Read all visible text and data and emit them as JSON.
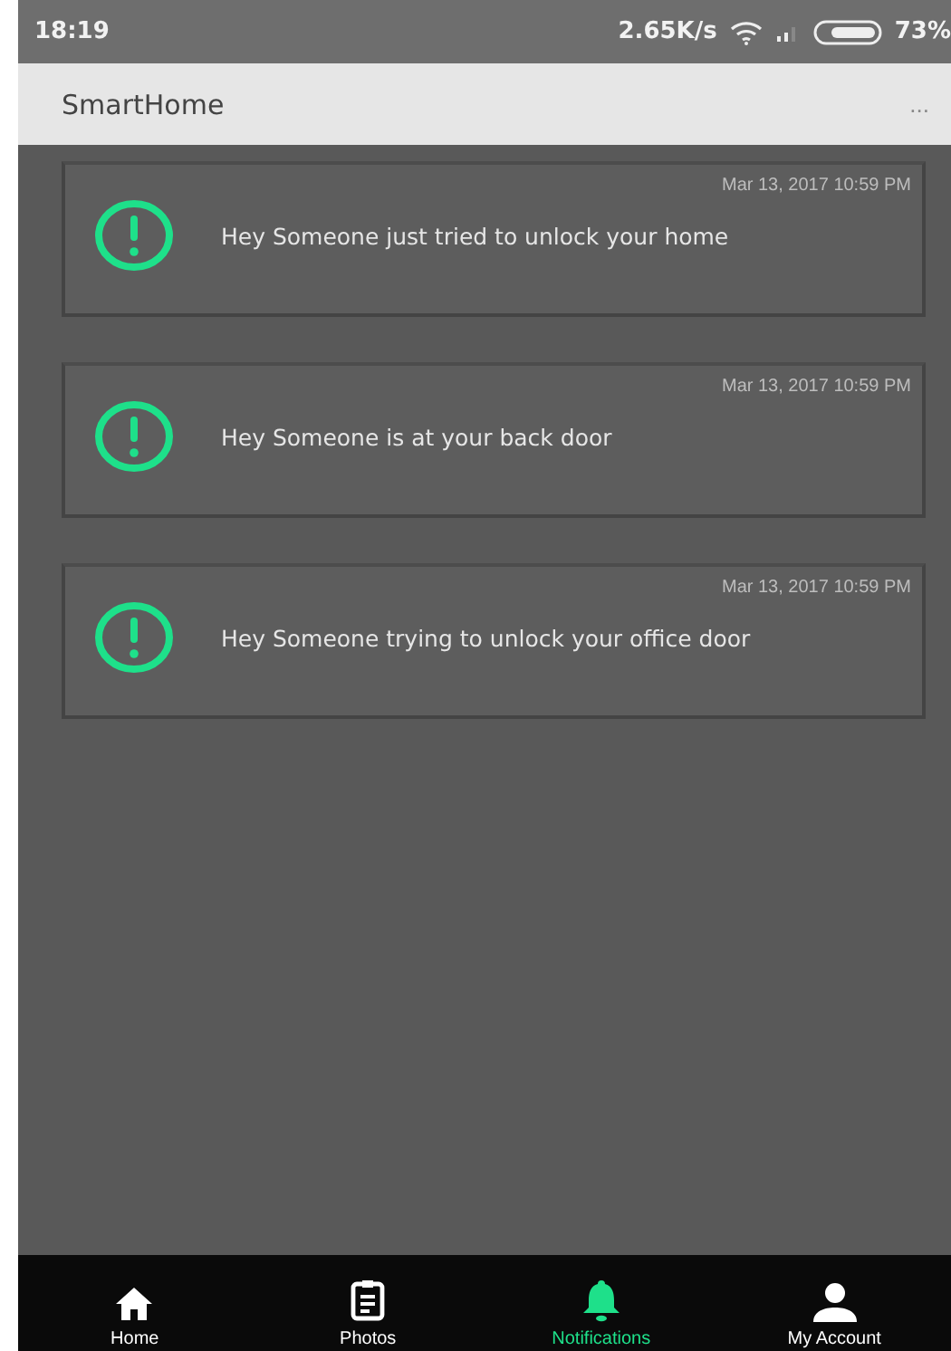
{
  "status_bar": {
    "time": "18:19",
    "speed": "2.65K/s",
    "battery": "73%"
  },
  "app_bar": {
    "title": "SmartHome",
    "menu": "..."
  },
  "notifications": [
    {
      "timestamp": "Mar 13, 2017 10:59 PM",
      "message": "Hey Someone just tried to unlock your home"
    },
    {
      "timestamp": "Mar 13, 2017 10:59 PM",
      "message": "Hey Someone is at your back door"
    },
    {
      "timestamp": "Mar 13, 2017 10:59 PM",
      "message": "Hey Someone trying to unlock your office door"
    }
  ],
  "tabs": [
    {
      "kind": "home",
      "label": "Home",
      "selected": false
    },
    {
      "kind": "photos",
      "label": "Photos",
      "selected": false
    },
    {
      "kind": "notifications",
      "label": "Notifications",
      "selected": true
    },
    {
      "kind": "account",
      "label": "My Account",
      "selected": false
    }
  ]
}
